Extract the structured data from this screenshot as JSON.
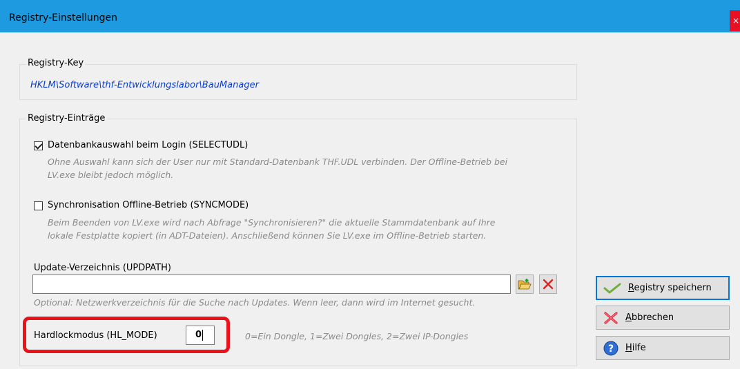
{
  "window": {
    "title": "Registry-Einstellungen",
    "close_glyph": "×"
  },
  "registry_key": {
    "group_label": "Registry-Key",
    "path": "HKLM\\Software\\thf-Entwicklungslabor\\BauManager"
  },
  "entries": {
    "group_label": "Registry-Einträge",
    "selectudl": {
      "label": "Datenbankauswahl beim Login (SELECTUDL)",
      "checked": true,
      "desc_line1": "Ohne Auswahl kann sich der User nur mit Standard-Datenbank THF.UDL verbinden. Der Offline-Betrieb bei",
      "desc_line2": "LV.exe bleibt jedoch möglich."
    },
    "syncmode": {
      "label": "Synchronisation Offline-Betrieb (SYNCMODE)",
      "checked": false,
      "desc_line1": "Beim Beenden von LV.exe wird nach Abfrage \"Synchronisieren?\" die aktuelle Stammdatenbank auf Ihre",
      "desc_line2": "lokale Festplatte kopiert (in ADT-Dateien). Anschließend können Sie LV.exe im Offline-Betrieb starten."
    },
    "updpath": {
      "label": "Update-Verzeichnis (UPDPATH)",
      "value": "",
      "hint": "Optional: Netzwerkverzeichnis für die Suche nach Updates. Wenn leer, dann wird im Internet gesucht.",
      "browse_icon": "folder-open-icon",
      "clear_icon": "red-x-icon"
    },
    "hl_mode": {
      "label": "Hardlockmodus (HL_MODE)",
      "value": "0",
      "hint": "0=Ein Dongle, 1=Zwei Dongles, 2=Zwei IP-Dongles"
    }
  },
  "buttons": {
    "save": {
      "underline_char": "R",
      "rest": "egistry speichern",
      "icon": "checkmark-icon"
    },
    "cancel": {
      "underline_char": "A",
      "rest": "bbrechen",
      "icon": "red-x-icon"
    },
    "help": {
      "underline_char": "H",
      "rest": "ilfe",
      "icon": "help-icon"
    }
  },
  "colors": {
    "titlebar": "#1e9be0",
    "link": "#0b3fd1",
    "highlight": "#e8141c",
    "default_button_border": "#0078d7"
  }
}
